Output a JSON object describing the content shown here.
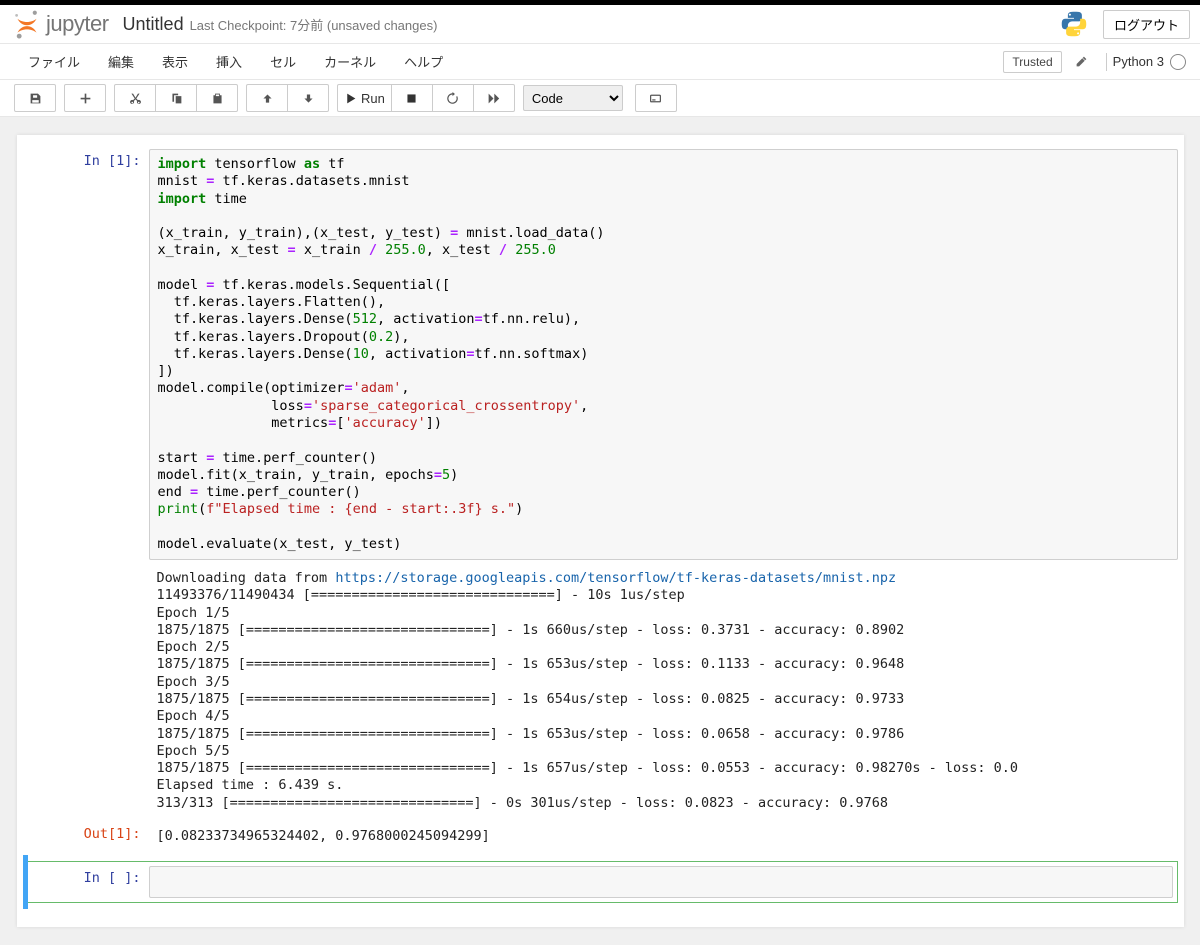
{
  "header": {
    "logo_text": "jupyter",
    "title": "Untitled",
    "checkpoint": "Last Checkpoint: 7分前  (unsaved changes)",
    "logout": "ログアウト"
  },
  "menubar": {
    "file": "ファイル",
    "edit": "編集",
    "view": "表示",
    "insert": "挿入",
    "cell": "セル",
    "kernel": "カーネル",
    "help": "ヘルプ",
    "trusted": "Trusted",
    "kernel_name": "Python 3"
  },
  "toolbar": {
    "run_label": "Run",
    "cell_type": "Code"
  },
  "cells": {
    "c1": {
      "in_prompt": "In [1]:",
      "out_text_prompt": "",
      "out_prompt": "Out[1]:",
      "code_lines": {
        "l1a": "import",
        "l1b": " tensorflow ",
        "l1c": "as",
        "l1d": " tf",
        "l2a": "mnist ",
        "l2b": "=",
        "l2c": " tf.keras.datasets.mnist",
        "l3a": "import",
        "l3b": " time",
        "l5a": "(x_train, y_train),(x_test, y_test) ",
        "l5b": "=",
        "l5c": " mnist.load_data()",
        "l6a": "x_train, x_test ",
        "l6b": "=",
        "l6c": " x_train ",
        "l6d": "/",
        "l6e": " ",
        "l6v1": "255.0",
        "l6f": ", x_test ",
        "l6g": "/",
        "l6h": " ",
        "l6v2": "255.0",
        "l8a": "model ",
        "l8b": "=",
        "l8c": " tf.keras.models.Sequential([",
        "l9": "  tf.keras.layers.Flatten(),",
        "l10a": "  tf.keras.layers.Dense(",
        "l10v": "512",
        "l10b": ", activation",
        "l10c": "=",
        "l10d": "tf.nn.relu),",
        "l11a": "  tf.keras.layers.Dropout(",
        "l11v": "0.2",
        "l11b": "),",
        "l12a": "  tf.keras.layers.Dense(",
        "l12v": "10",
        "l12b": ", activation",
        "l12c": "=",
        "l12d": "tf.nn.softmax)",
        "l13": "])",
        "l14a": "model.compile(optimizer",
        "l14b": "=",
        "l14s": "'adam'",
        "l14c": ",",
        "l15a": "              loss",
        "l15b": "=",
        "l15s": "'sparse_categorical_crossentropy'",
        "l15c": ",",
        "l16a": "              metrics",
        "l16b": "=",
        "l16c": "[",
        "l16s": "'accuracy'",
        "l16d": "])",
        "l18a": "start ",
        "l18b": "=",
        "l18c": " time.perf_counter()",
        "l19a": "model.fit(x_train, y_train, epochs",
        "l19b": "=",
        "l19v": "5",
        "l19c": ")",
        "l20a": "end ",
        "l20b": "=",
        "l20c": " time.perf_counter()",
        "l21a": "print",
        "l21b": "(",
        "l21s1": "f\"Elapsed time : ",
        "l21s2": "{end - start:",
        "l21s3": ".3f}",
        "l21s4": " s.\"",
        "l21c": ")",
        "l23": "model.evaluate(x_test, y_test)"
      },
      "stdout": "Downloading data from https://storage.googleapis.com/tensorflow/tf-keras-datasets/mnist.npz\n11493376/11490434 [==============================] - 10s 1us/step\nEpoch 1/5\n1875/1875 [==============================] - 1s 660us/step - loss: 0.3731 - accuracy: 0.8902\nEpoch 2/5\n1875/1875 [==============================] - 1s 653us/step - loss: 0.1133 - accuracy: 0.9648\nEpoch 3/5\n1875/1875 [==============================] - 1s 654us/step - loss: 0.0825 - accuracy: 0.9733\nEpoch 4/5\n1875/1875 [==============================] - 1s 653us/step - loss: 0.0658 - accuracy: 0.9786\nEpoch 5/5\n1875/1875 [==============================] - 1s 657us/step - loss: 0.0553 - accuracy: 0.98270s - loss: 0.0\nElapsed time : 6.439 s.\n313/313 [==============================] - 0s 301us/step - loss: 0.0823 - accuracy: 0.9768",
      "stdout_prefix": "Downloading data from ",
      "stdout_url": "https://storage.googleapis.com/tensorflow/tf-keras-datasets/mnist.npz",
      "result": "[0.08233734965324402, 0.9768000245094299]"
    },
    "c2": {
      "in_prompt": "In [ ]:"
    }
  }
}
